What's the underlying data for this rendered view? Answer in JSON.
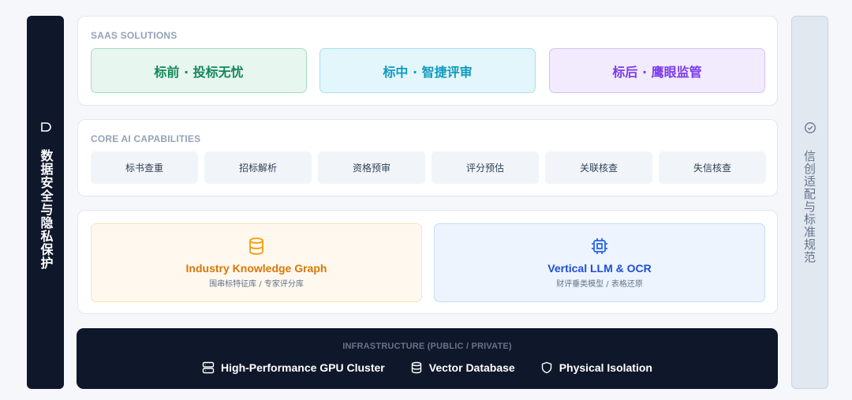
{
  "left_panel": {
    "label": "数据安全与隐私保护",
    "icon": "shield-icon"
  },
  "right_panel": {
    "label": "信创适配与标准规范",
    "icon": "check-circle-icon"
  },
  "saas": {
    "title": "SAAS SOLUTIONS",
    "items": [
      {
        "label": "标前 · 投标无忧",
        "color": "#14875a"
      },
      {
        "label": "标中 · 智捷评审",
        "color": "#0e9bc0"
      },
      {
        "label": "标后 · 鹰眼监管",
        "color": "#7c3aed"
      }
    ]
  },
  "core": {
    "title": "CORE AI CAPABILITIES",
    "items": [
      "标书查重",
      "招标解析",
      "资格预审",
      "评分预估",
      "关联核查",
      "失信核查"
    ]
  },
  "foundation": {
    "kg": {
      "title": "Industry Knowledge Graph",
      "subtitle": "围串标特征库 / 专家评分库",
      "icon": "database-icon"
    },
    "llm": {
      "title": "Vertical LLM & OCR",
      "subtitle": "财评垂类模型 / 表格还原",
      "icon": "chip-icon"
    }
  },
  "infrastructure": {
    "title": "INFRASTRUCTURE (PUBLIC / PRIVATE)",
    "items": [
      {
        "label": "High-Performance GPU Cluster",
        "icon": "server-icon"
      },
      {
        "label": "Vector Database",
        "icon": "database-icon"
      },
      {
        "label": "Physical Isolation",
        "icon": "shield-icon"
      }
    ]
  }
}
